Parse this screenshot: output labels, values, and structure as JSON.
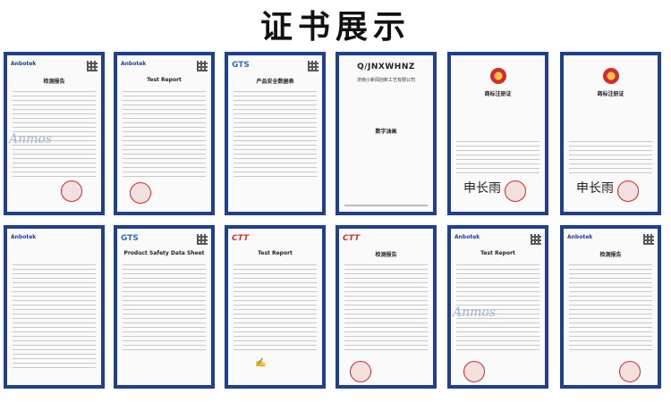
{
  "page": {
    "title": "证书展示"
  },
  "row1": [
    {
      "logo": "Anbotek",
      "doc_title": "检测报告",
      "watermark": "Anmos",
      "seal": true,
      "emblem": false
    },
    {
      "logo": "Anbotek",
      "doc_title": "Test Report",
      "watermark": "",
      "seal": true,
      "emblem": false
    },
    {
      "logo": "GTS",
      "doc_title": "产品安全数据表",
      "watermark": "",
      "seal": false,
      "emblem": false
    },
    {
      "logo": "",
      "doc_title": "",
      "watermark": "",
      "seal": false,
      "emblem": false,
      "standard": "Q/JNXWHNZ",
      "company": "济南小新闻创新工艺有限公司",
      "middle": "数字油画"
    },
    {
      "logo": "",
      "doc_title": "商标注册证",
      "watermark": "",
      "seal": true,
      "emblem": true,
      "signature": "申长雨"
    },
    {
      "logo": "",
      "doc_title": "商标注册证",
      "watermark": "",
      "seal": true,
      "emblem": true,
      "signature": "申长雨"
    }
  ],
  "row2": [
    {
      "logo": "Anbotek",
      "doc_title": "",
      "watermark": "",
      "seal": false,
      "emblem": false
    },
    {
      "logo": "GTS",
      "doc_title": "Product Safety Data Sheet",
      "watermark": "",
      "seal": false,
      "emblem": false
    },
    {
      "logo": "CTT",
      "doc_title": "Test Report",
      "watermark": "",
      "seal": false,
      "emblem": false
    },
    {
      "logo": "CTT",
      "doc_title": "检测报告",
      "watermark": "",
      "seal": true,
      "emblem": false
    },
    {
      "logo": "Anbotek",
      "doc_title": "Test Report",
      "watermark": "Anmos",
      "seal": true,
      "emblem": false
    },
    {
      "logo": "Anbotek",
      "doc_title": "检测报告",
      "watermark": "",
      "seal": true,
      "emblem": false
    }
  ]
}
